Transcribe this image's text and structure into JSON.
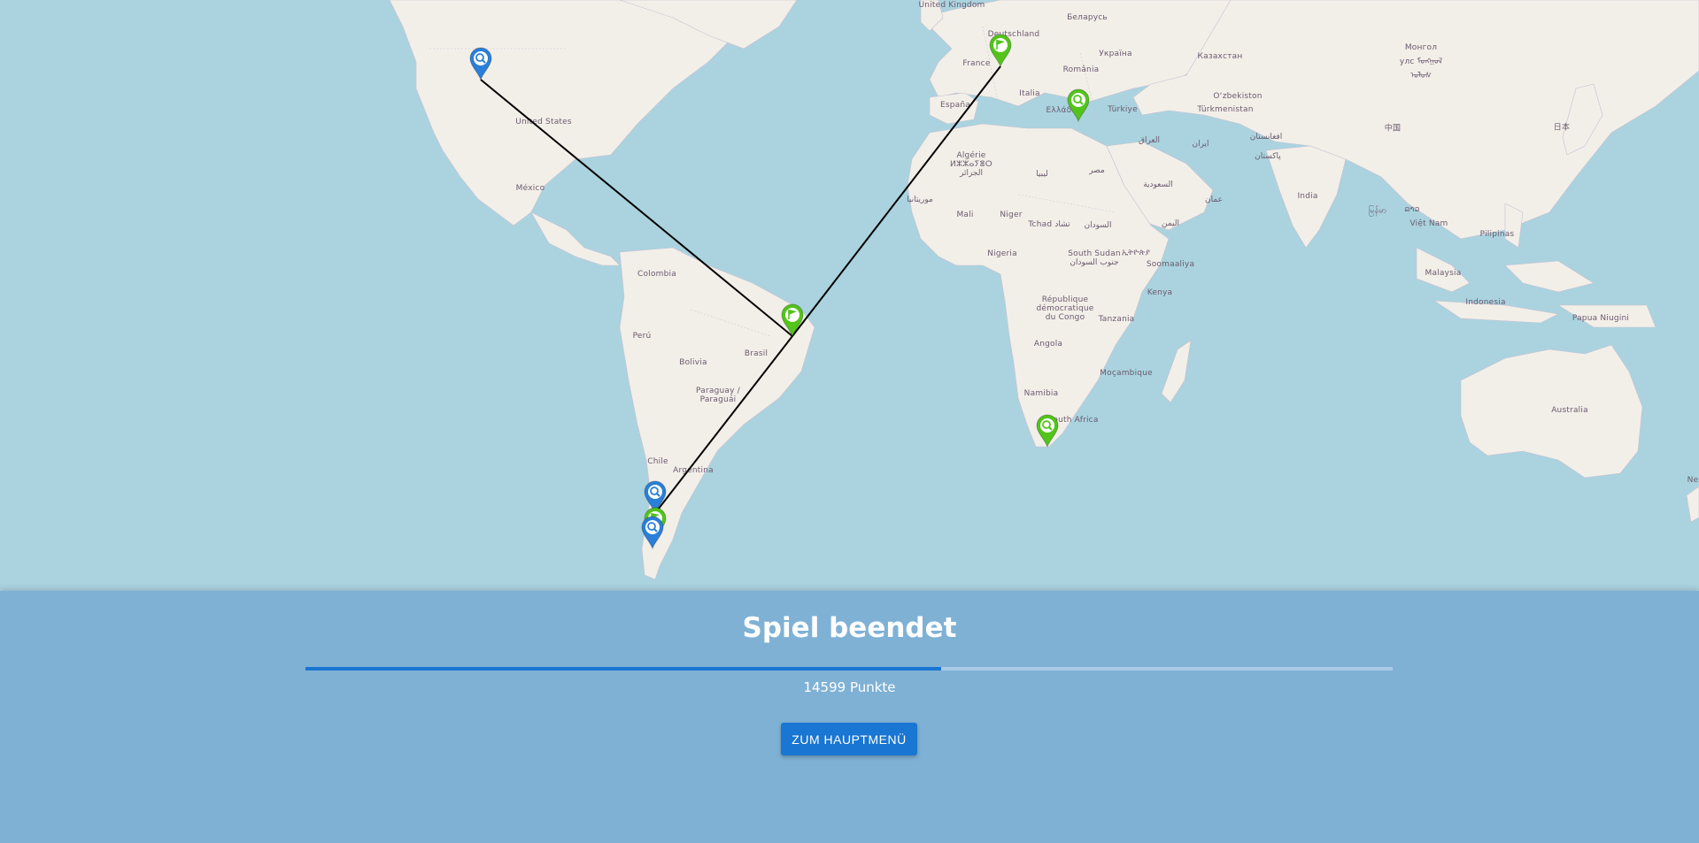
{
  "map": {
    "labels": {
      "uk": "United Kingdom",
      "de": "Deutschland",
      "by": "Беларусь",
      "ua": "Україна",
      "kz": "Казахстан",
      "mn": "Монгол\nулс ᠮᠣᠩᠭᠣᠯ\nᠤᠯᠤᠰ",
      "fr": "France",
      "it": "Italia",
      "ro": "România",
      "es": "España",
      "gr": "Ελλάδα",
      "tr": "Türkiye",
      "uz": "O‘zbekiston",
      "tm": "Türkmenistan",
      "cn": "中国",
      "jp": "日本",
      "iq": "العراق",
      "ir": "ایران",
      "af": "افغانستان",
      "pk": "پاکستان",
      "dz": "Algérie\nⵍⵣⵣⴰⵢⴻⵔ\nالجزائر",
      "ly": "ليبيا",
      "eg": "مصر",
      "sa": "السعودية",
      "om": "عمان",
      "ye": "اليمن",
      "in": "India",
      "mm": "မြန်မာ",
      "la": "ລາວ",
      "vn": "Việt Nam",
      "ph": "Pilipinas",
      "my": "Malaysia",
      "id": "Indonesia",
      "pg": "Papua Niugini",
      "mr": "موريتانيا",
      "ml": "Mali",
      "ne": "Niger",
      "td": "Tchad تشاد",
      "sd": "السودان",
      "ng": "Nigeria",
      "ss": "South Sudan\nجنوب السودان",
      "et": "ኢትዮጵያ",
      "so": "Soomaaliya",
      "ke": "Kenya",
      "cd": "République\ndémocratique\ndu Congo",
      "tz": "Tanzania",
      "ao": "Angola",
      "mz": "Moçambique",
      "na": "Namibia",
      "za": "South Africa",
      "au": "Australia",
      "us": "United States",
      "mx": "México",
      "co": "Colombia",
      "pe": "Perú",
      "br": "Brasil",
      "bo": "Bolivia",
      "py": "Paraguay /\nParaguái",
      "cl": "Chile",
      "ar": "Argentina",
      "nz": "Ne"
    },
    "markers": [
      {
        "kind": "guess",
        "icon": "magnifier-icon",
        "color": "#2a7fd8"
      },
      {
        "kind": "target",
        "icon": "flag-icon",
        "color": "#52c41a"
      },
      {
        "kind": "target",
        "icon": "flag-icon",
        "color": "#52c41a"
      },
      {
        "kind": "guess",
        "icon": "magnifier-icon",
        "color": "#2a7fd8"
      },
      {
        "kind": "guess",
        "icon": "magnifier-icon",
        "color": "#52c41a"
      },
      {
        "kind": "guess",
        "icon": "magnifier-icon",
        "color": "#52c41a"
      },
      {
        "kind": "target",
        "icon": "flag-icon",
        "color": "#52c41a"
      },
      {
        "kind": "guess",
        "icon": "magnifier-icon",
        "color": "#2a7fd8"
      }
    ]
  },
  "panel": {
    "title": "Spiel beendet",
    "progress": 0.585,
    "score_text": "14599 Punkte",
    "button_label": "ZUM HAUPTMENÜ"
  },
  "colors": {
    "water": "#aad3df",
    "land": "#f2efe9",
    "panel": "#7fb1d5",
    "accent": "#1976d2",
    "progress_track": "#aac9e6",
    "guess_marker": "#2a7fd8",
    "target_marker": "#52c41a"
  }
}
